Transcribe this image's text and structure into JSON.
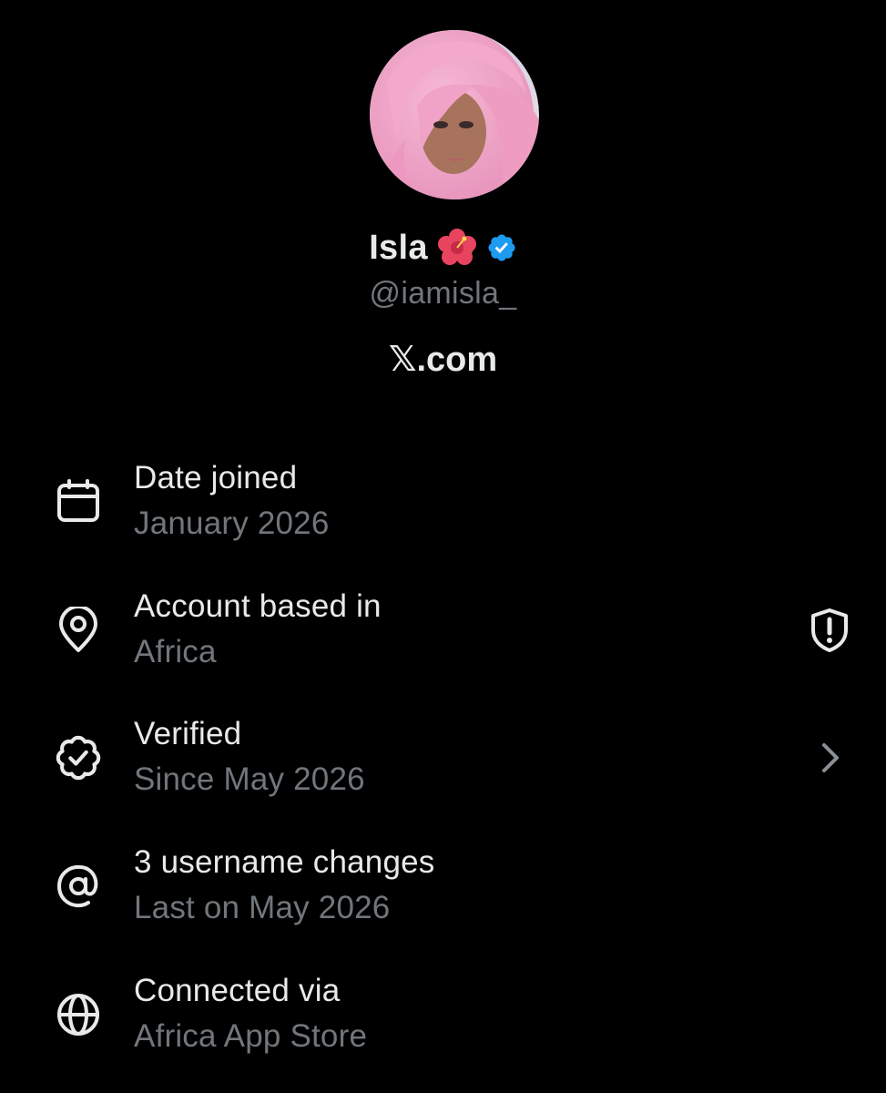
{
  "profile": {
    "display_name": "Isla",
    "name_emoji": "hibiscus-icon",
    "verified_badge": "verified-badge-icon",
    "handle": "@iamisla_",
    "site_label": "𝕏.com",
    "avatar": "pink-haired-portrait"
  },
  "rows": [
    {
      "title": "Date joined",
      "value": "January 2026",
      "icon": "calendar-icon"
    },
    {
      "title": "Account based in",
      "value": "Africa",
      "icon": "location-pin-icon",
      "trailing_icon": "shield-alert-icon"
    },
    {
      "title": "Verified",
      "value": "Since May 2026",
      "icon": "verified-seal-icon",
      "trailing_icon": "chevron-right-icon"
    },
    {
      "title": "3 username changes",
      "value": "Last on May 2026",
      "icon": "at-sign-icon"
    },
    {
      "title": "Connected via",
      "value": "Africa App Store",
      "icon": "globe-icon"
    }
  ],
  "colors": {
    "background": "#000000",
    "primary_text": "#e7e9ea",
    "secondary_text": "#71767b",
    "verified_blue": "#1d9bf0"
  }
}
